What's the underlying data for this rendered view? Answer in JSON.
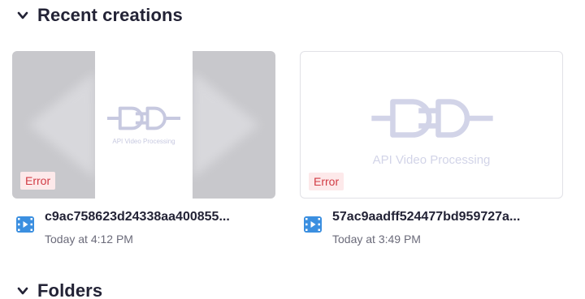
{
  "sections": {
    "recent": {
      "title": "Recent creations",
      "icon": "chevron-down-icon"
    },
    "folders": {
      "title": "Folders",
      "icon": "chevron-down-icon"
    }
  },
  "cards": [
    {
      "thumbnail_caption": "API Video Processing",
      "status": "Error",
      "filename": "c9ac758623d24338aa400855...",
      "time": "Today at 4:12 PM",
      "file_icon": "video-file-icon"
    },
    {
      "thumbnail_caption": "API Video Processing",
      "status": "Error",
      "filename": "57ac9aadff524477bd959727a...",
      "time": "Today at 3:49 PM",
      "file_icon": "video-file-icon"
    }
  ],
  "colors": {
    "error_bg": "#fde9ea",
    "error_text": "#d13b44",
    "logo": "#c7c9e0",
    "file_icon": "#3b8fe0"
  }
}
